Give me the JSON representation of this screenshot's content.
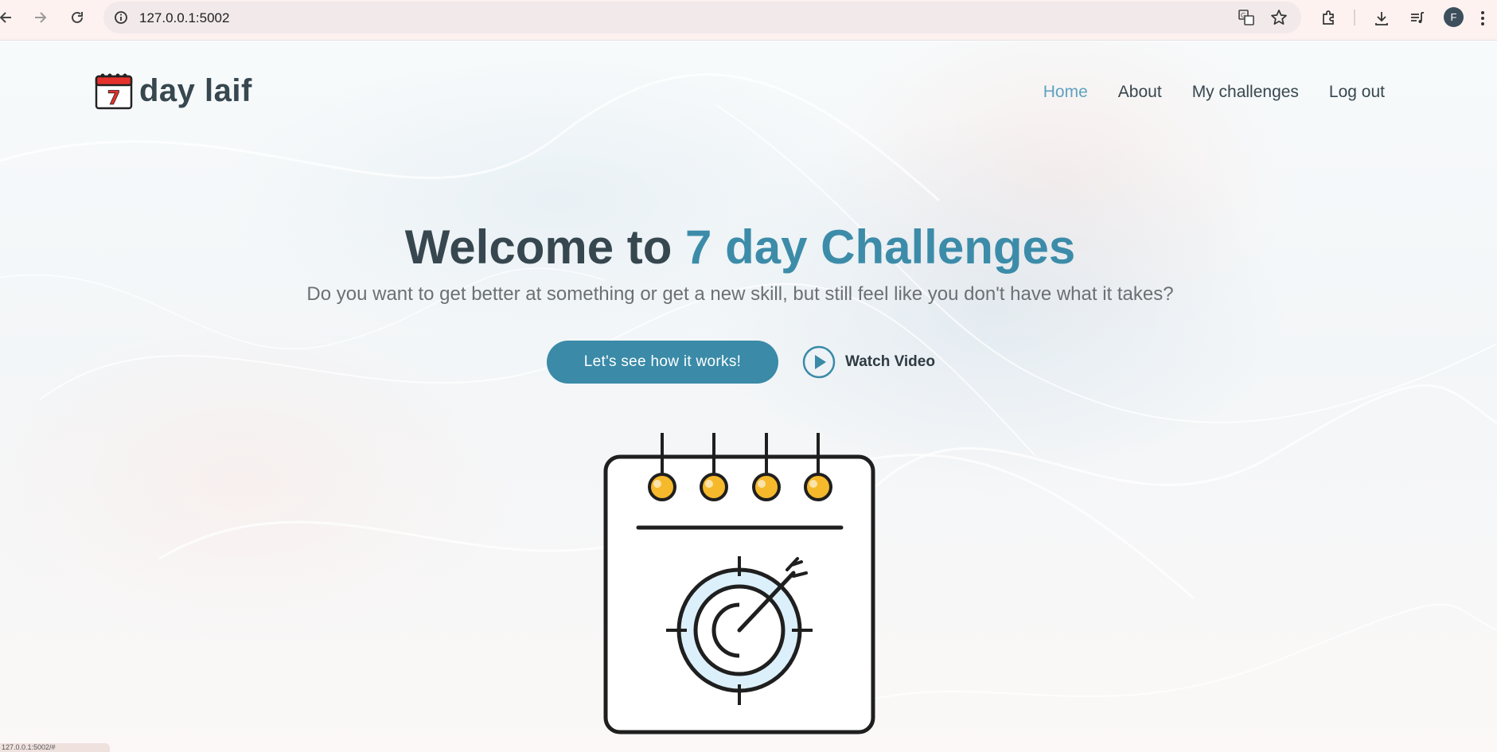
{
  "browser": {
    "url": "127.0.0.1:5002",
    "avatar_initial": "F",
    "icons": [
      "back-icon",
      "forward-icon",
      "reload-icon",
      "site-info-icon",
      "translate-icon",
      "bookmark-star-icon",
      "extensions-icon",
      "download-icon",
      "media-queue-icon",
      "kebab-menu-icon"
    ]
  },
  "site": {
    "logo_badge": "7",
    "logo_text": "day laif",
    "nav": [
      {
        "label": "Home",
        "active": true
      },
      {
        "label": "About",
        "active": false
      },
      {
        "label": "My challenges",
        "active": false
      },
      {
        "label": "Log out",
        "active": false
      }
    ]
  },
  "hero": {
    "title_prefix": "Welcome to ",
    "title_accent": "7 day Challenges",
    "subtitle": "Do you want to get better at something or get a new skill, but still feel like you don't have what it takes?",
    "cta_label": "Let's see how it works!",
    "video_label": "Watch Video"
  },
  "status_bar": "127.0.0.1:5002/#",
  "colors": {
    "accent": "#3a8aa8",
    "active_nav": "#5fa3c0",
    "text_dark": "#37474f",
    "ring_fill": "#f6b92b",
    "target_fill": "#dcf0fb"
  }
}
